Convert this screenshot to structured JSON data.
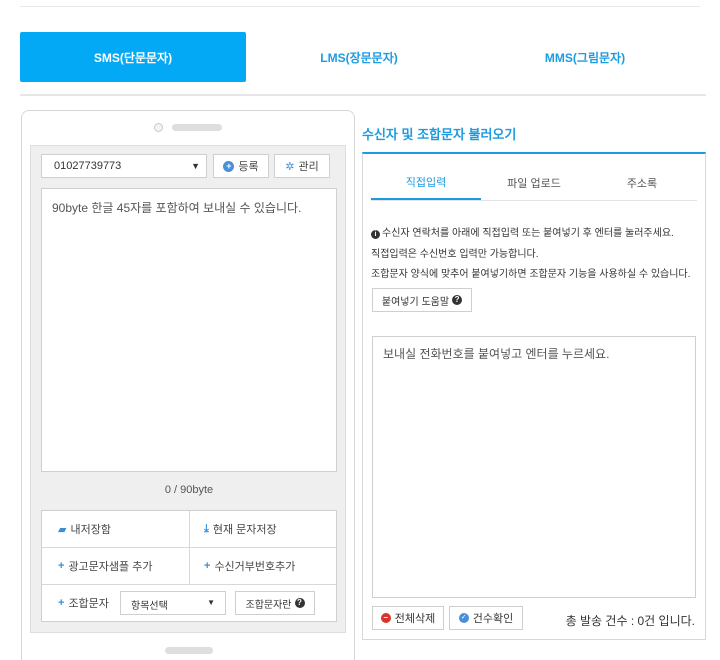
{
  "tabs": [
    {
      "label": "SMS(단문문자)"
    },
    {
      "label": "LMS(장문문자)"
    },
    {
      "label": "MMS(그림문자)"
    }
  ],
  "phone": {
    "sender_number": "01027739773",
    "register_label": "등록",
    "manage_label": "관리",
    "message_placeholder": "90byte 한글 45자를 포함하여 보내실 수 있습니다.",
    "byte_count": "0 / 90byte",
    "actions": {
      "my_storage": "내저장함",
      "save_current": "현재 문자저장",
      "add_ad_sample": "광고문자샘플 추가",
      "add_reject_number": "수신거부번호추가",
      "combo_label": "조합문자",
      "combo_select": "항목선택",
      "combo_help": "조합문자란"
    }
  },
  "right": {
    "title": "수신자 및 조합문자 불러오기",
    "tabs": [
      {
        "label": "직접입력"
      },
      {
        "label": "파일 업로드"
      },
      {
        "label": "주소록"
      }
    ],
    "info_lines": [
      "수신자 연락처를 아래에 직접입력 또는 붙여넣기 후 엔터를 눌러주세요.",
      "직접입력은 수신번호 입력만 가능합니다.",
      "조합문자 양식에 맞추어 붙여넣기하면 조합문자 기능을 사용하실 수 있습니다."
    ],
    "paste_help_label": "붙여넣기 도움말",
    "phone_input_placeholder": "보내실 전화번호를 붙여넣고 엔터를 누르세요.",
    "delete_all_label": "전체삭제",
    "count_check_label": "건수확인",
    "total_text": "총 발송 건수 : 0건 입니다."
  },
  "colors": {
    "accent": "#03a9f4",
    "link": "#1d9be0",
    "delete": "#d9342b"
  }
}
